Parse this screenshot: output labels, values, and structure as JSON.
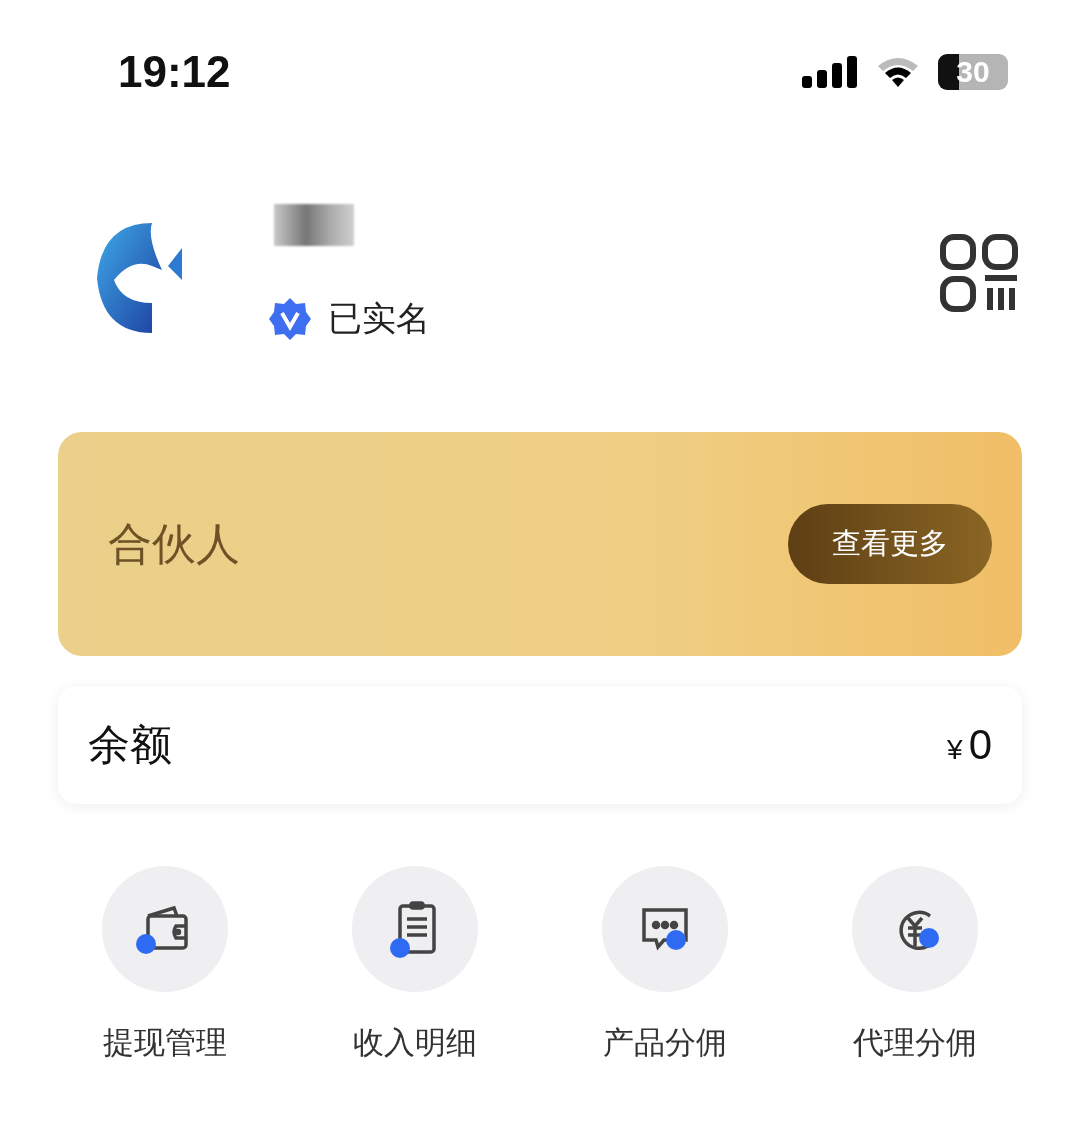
{
  "status_bar": {
    "time": "19:12",
    "battery": "30"
  },
  "profile": {
    "verified": true,
    "verified_label": "已实名"
  },
  "partner_card": {
    "title": "合伙人",
    "button": "查看更多"
  },
  "balance": {
    "label": "余额",
    "currency": "¥",
    "amount": "0"
  },
  "menu": [
    {
      "kind": "wallet",
      "label": "提现管理"
    },
    {
      "kind": "clipboard",
      "label": "收入明细"
    },
    {
      "kind": "chat",
      "label": "产品分佣"
    },
    {
      "kind": "yuan",
      "label": "代理分佣"
    }
  ]
}
